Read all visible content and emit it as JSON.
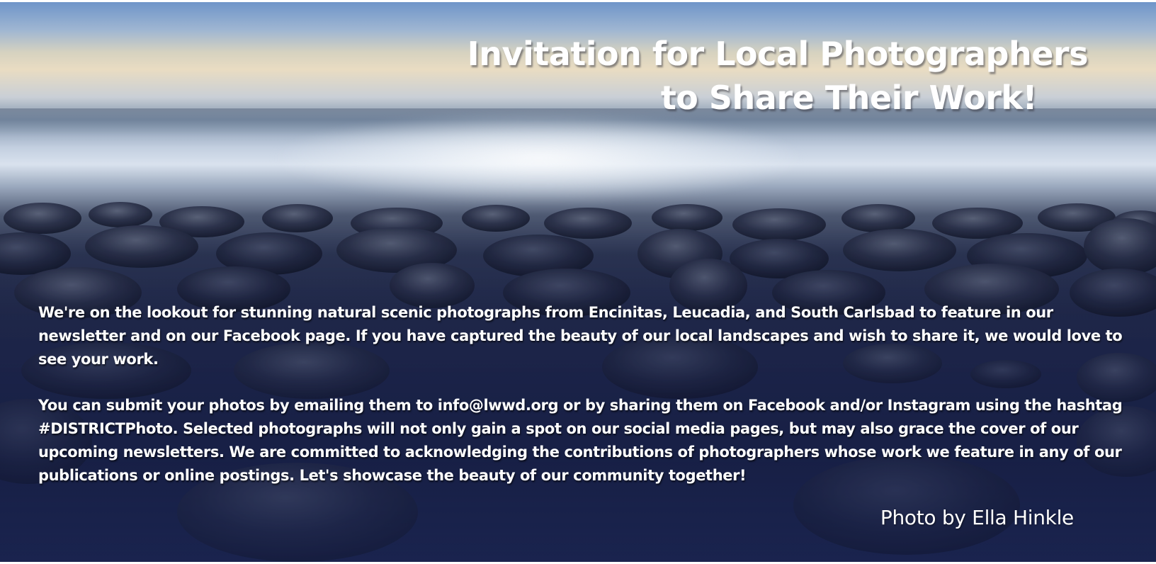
{
  "banner": {
    "headline_line1": "Invitation for Local Photographers",
    "headline_line2": "to Share Their Work!",
    "paragraph1": "We're on the lookout for stunning natural scenic photographs from Encinitas, Leucadia, and South Carlsbad to feature in our newsletter and on our Facebook page. If you have captured the beauty of our local landscapes and wish to share it, we would love to see your work.",
    "paragraph2": "You can submit your photos by emailing them to info@lwwd.org or by sharing them on Facebook and/or Instagram using the hashtag #DISTRICTPhoto. Selected photographs will not only gain a spot on our social media pages, but may also grace the cover of our upcoming newsletters. We are committed to acknowledging the contributions of photographers whose work we feature in any of our publications or online postings. Let's showcase the beauty of our community together!",
    "photo_credit": "Photo by Ella Hinkle"
  },
  "background": {
    "description_icon": "beach-pebbles-photo",
    "sky_color": "#6f95c9",
    "overlay_color": "#1d2548"
  }
}
